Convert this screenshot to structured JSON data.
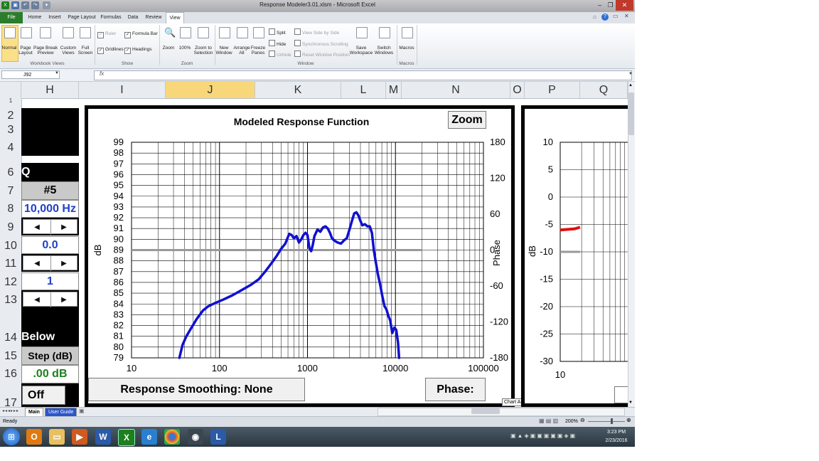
{
  "window": {
    "title": "Response Modeler3.01.xlsm - Microsoft Excel",
    "buttons": [
      "–",
      "❐",
      "✕"
    ]
  },
  "ribbon_tabs": [
    "File",
    "Home",
    "Insert",
    "Page Layout",
    "Formulas",
    "Data",
    "Review",
    "View"
  ],
  "ribbon": {
    "workbook_views": {
      "buttons": [
        "Normal",
        "Page Layout",
        "Page Break Preview",
        "Custom Views",
        "Full Screen"
      ],
      "group_label": "Workbook Views"
    },
    "show": {
      "items": [
        {
          "label": "Ruler",
          "checked": true,
          "enabled": false
        },
        {
          "label": "Formula Bar",
          "checked": true,
          "enabled": true
        },
        {
          "label": "Gridlines",
          "checked": true,
          "enabled": true
        },
        {
          "label": "Headings",
          "checked": true,
          "enabled": true
        }
      ],
      "group_label": "Show"
    },
    "zoom": {
      "buttons": [
        "Zoom",
        "100%",
        "Zoom to Selection"
      ],
      "group_label": "Zoom"
    },
    "window": {
      "buttons": [
        "New Window",
        "Arrange All",
        "Freeze Panes"
      ],
      "small": [
        "Split",
        "Hide",
        "Unhide"
      ],
      "small2": [
        "View Side by Side",
        "Synchronous Scrolling",
        "Reset Window Position"
      ],
      "buttons2": [
        "Save Workspace",
        "Switch Windows"
      ],
      "group_label": "Window"
    },
    "macros": {
      "buttons": [
        "Macros"
      ],
      "group_label": "Macros"
    }
  },
  "formula_bar": {
    "name_box": "J92",
    "fx": "fx",
    "formula": ""
  },
  "columns": [
    "H",
    "I",
    "J",
    "K",
    "L",
    "M",
    "N",
    "O",
    "P",
    "Q"
  ],
  "selected_column": "J",
  "rows": [
    "1",
    "2",
    "3",
    "4",
    "6",
    "7",
    "8",
    "9",
    "10",
    "11",
    "12",
    "13",
    "14",
    "15",
    "16",
    "17"
  ],
  "left_panel": {
    "row6": "Q",
    "preset": "#5",
    "frequency": "10,000 Hz",
    "value1": "0.0",
    "value2": "1",
    "row14": "Below",
    "step_label": "Step (dB)",
    "step_value": ".00 dB",
    "toggle": "Off",
    "colors": {
      "blue": "#1f3fc8",
      "green": "#1d7f1d"
    }
  },
  "chart_data": [
    {
      "type": "line",
      "title": "Modeled Response Function",
      "xlabel": "",
      "ylabel": "dB",
      "y2label": "Phase",
      "xscale": "log",
      "xlim": [
        10,
        100000
      ],
      "ylim": [
        79,
        99
      ],
      "y2lim": [
        -180,
        180
      ],
      "x_ticks": [
        "10",
        "100",
        "1000",
        "10000",
        "100000"
      ],
      "y_ticks": [
        "79",
        "80",
        "81",
        "82",
        "83",
        "84",
        "85",
        "86",
        "87",
        "88",
        "89",
        "90",
        "91",
        "92",
        "93",
        "94",
        "95",
        "96",
        "97",
        "98",
        "99"
      ],
      "y2_ticks": [
        "180",
        "120",
        "60",
        "0",
        "-60",
        "-120",
        "-180"
      ],
      "grid": true,
      "series": [
        {
          "color": "#1010d0",
          "x": [
            35,
            38,
            42,
            48,
            55,
            65,
            75,
            90,
            110,
            140,
            180,
            230,
            280,
            300,
            330,
            360,
            400,
            450,
            500,
            560,
            620,
            660,
            700,
            750,
            800,
            850,
            900,
            950,
            1000,
            1050,
            1100,
            1150,
            1200,
            1300,
            1400,
            1500,
            1600,
            1700,
            1800,
            1900,
            2000,
            2200,
            2400,
            2600,
            2800,
            3000,
            3200,
            3400,
            3600,
            3800,
            4000,
            4200,
            4500,
            4800,
            5100,
            5400,
            5700,
            6000,
            6300,
            6700,
            7100,
            7500,
            7900,
            8300,
            8700,
            9200,
            9700,
            10200,
            10700,
            11000
          ],
          "y": [
            79.0,
            80.2,
            81.0,
            81.8,
            82.6,
            83.4,
            83.8,
            84.1,
            84.4,
            84.8,
            85.3,
            85.8,
            86.3,
            86.6,
            87.0,
            87.4,
            87.9,
            88.5,
            89.1,
            89.6,
            90.5,
            90.4,
            90.1,
            90.3,
            89.7,
            90.0,
            90.4,
            90.6,
            90.4,
            89.2,
            88.9,
            89.5,
            90.3,
            90.9,
            90.7,
            91.1,
            91.2,
            91.0,
            90.6,
            90.1,
            89.9,
            89.7,
            89.6,
            89.9,
            90.1,
            90.9,
            91.7,
            92.4,
            92.5,
            92.2,
            91.7,
            91.3,
            91.4,
            91.2,
            91.2,
            90.6,
            88.9,
            87.8,
            86.8,
            85.8,
            84.7,
            83.8,
            83.5,
            82.9,
            82.5,
            81.3,
            81.8,
            81.6,
            80.4,
            79.0
          ]
        },
        {
          "color": "#999999",
          "x": [
            10,
            20000
          ],
          "y": [
            89,
            89
          ]
        }
      ]
    },
    {
      "type": "line",
      "title": "",
      "ylabel": "dB",
      "xscale": "log",
      "xlim": [
        10,
        100000
      ],
      "ylim": [
        -30,
        10
      ],
      "x_ticks": [
        "10"
      ],
      "y_ticks": [
        "10",
        "5",
        "0",
        "-5",
        "-10",
        "-15",
        "-20",
        "-25",
        "-30"
      ],
      "grid": true,
      "series": [
        {
          "color": "#e01010",
          "x": [
            10,
            13,
            16,
            19
          ],
          "y": [
            -6.0,
            -5.9,
            -5.8,
            -5.5
          ]
        },
        {
          "color": "#999999",
          "x": [
            10,
            19
          ],
          "y": [
            -10,
            -10
          ]
        }
      ]
    }
  ],
  "chart_buttons": {
    "zoom": "Zoom",
    "smoothing": "Response Smoothing: None",
    "phase": "Phase:"
  },
  "tooltip": "Chart Area",
  "sheet_tabs": [
    "Main",
    "User Guide"
  ],
  "status": {
    "ready": "Ready",
    "zoom": "200%"
  },
  "taskbar": {
    "apps": [
      "Outlook",
      "Explorer",
      "Media",
      "Word",
      "Excel",
      "IE",
      "Chrome",
      "Steam",
      "L"
    ],
    "time": "3:23 PM",
    "date": "2/23/2016"
  }
}
